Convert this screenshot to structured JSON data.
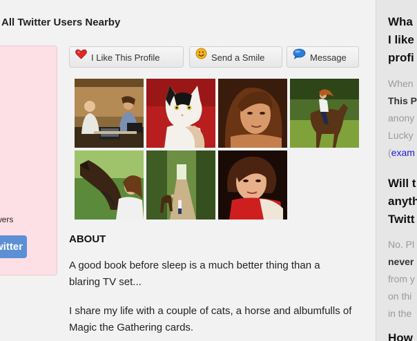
{
  "nearby_heading": "All Twitter Users Nearby",
  "profile_card": {
    "followers_fragment": "wers",
    "twitter_button_fragment": "witter"
  },
  "actions": {
    "like": {
      "label": "I Like This Profile",
      "icon": "heart-icon"
    },
    "smile": {
      "label": "Send a Smile",
      "icon": "smiley-icon"
    },
    "message": {
      "label": "Message",
      "icon": "speech-bubble-icon"
    }
  },
  "photos": [
    {
      "name": "photo-people-at-laptops"
    },
    {
      "name": "photo-cat"
    },
    {
      "name": "photo-woman-portrait"
    },
    {
      "name": "photo-horse-rider"
    },
    {
      "name": "photo-woman-with-horse"
    },
    {
      "name": "photo-forest-path-horse"
    },
    {
      "name": "photo-woman-red-scarf"
    }
  ],
  "about": {
    "title": "ABOUT",
    "paragraph1_line1": "A good book before sleep is a much better thing than a",
    "paragraph1_line2": "blaring TV set...",
    "paragraph2_line1": "I share my life with a couple of cats, a horse and albumfulls of",
    "paragraph2_line2": "Magic the Gathering cards."
  },
  "sidebar": {
    "q1_line1": "Wha",
    "q1_line2": "I like",
    "q1_line3": "profi",
    "a1_line1": "When",
    "a1_line2": "This P",
    "a1_line3": "anony",
    "a1_line4": "Lucky",
    "a1_line5_paren": "(",
    "a1_line5_link": "exam",
    "q2_line1": "Will t",
    "q2_line2": "anyth",
    "q2_line3": "Twitt",
    "a2_line1": "No. Pl",
    "a2_line2": "never",
    "a2_line3": "from y",
    "a2_line4": "on thi",
    "a2_line5": "in the",
    "q3_line1": "How"
  },
  "colors": {
    "page_bg": "#f2f2f2",
    "card_bg": "#fde0e6",
    "twitter_button": "#5d8fd4",
    "sidebar_bg": "#e6e6e6",
    "link": "#1a1adb"
  }
}
